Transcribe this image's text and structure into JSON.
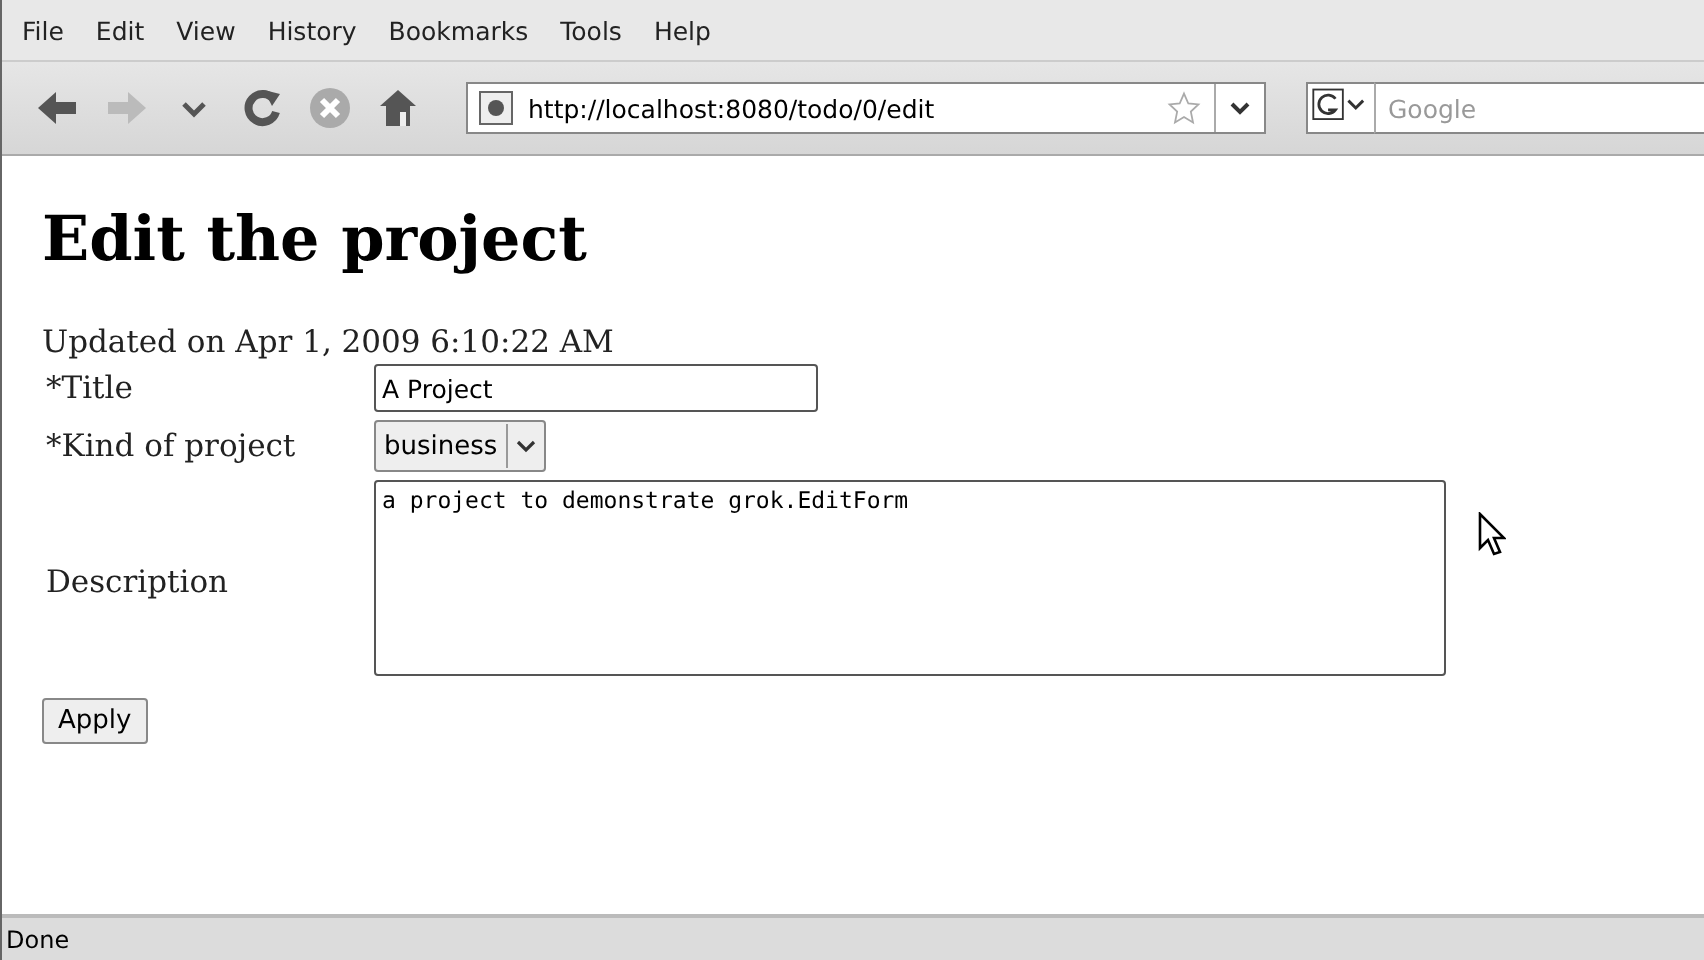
{
  "menu_bar": [
    "File",
    "Edit",
    "View",
    "History",
    "Bookmarks",
    "Tools",
    "Help"
  ],
  "toolbar": {
    "buttons": [
      {
        "kind": "back",
        "disabled": false
      },
      {
        "kind": "forward",
        "disabled": true
      },
      {
        "kind": "history",
        "disabled": false
      },
      {
        "kind": "reload",
        "disabled": false
      },
      {
        "kind": "stop",
        "disabled": false
      },
      {
        "kind": "home",
        "disabled": false
      }
    ],
    "address": "http://localhost:8080/todo/0/edit",
    "search": {
      "placeholder": "Google"
    }
  },
  "page": {
    "heading": "Edit the project",
    "updated": "Updated on Apr 1, 2009 6:10:22 AM",
    "fields": [
      {
        "kind": "text",
        "label": "*Title",
        "value": "A Project"
      },
      {
        "kind": "select",
        "label": "*Kind of project",
        "value": "business"
      },
      {
        "kind": "textarea",
        "label": "Description",
        "value": "a project to demonstrate grok.EditForm"
      }
    ],
    "submit": "Apply"
  },
  "status_bar": "Done"
}
